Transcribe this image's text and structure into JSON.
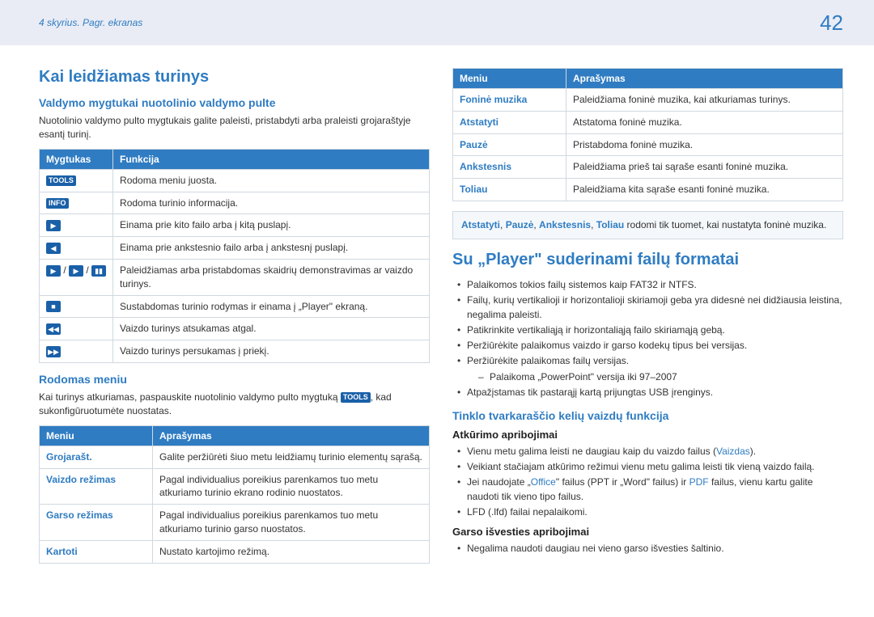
{
  "header": {
    "breadcrumb": "4 skyrius. Pagr. ekranas",
    "page": "42"
  },
  "left": {
    "h1": "Kai leidžiamas turinys",
    "h2_a": "Valdymo mygtukai nuotolinio valdymo pulte",
    "para_a": "Nuotolinio valdymo pulto mygtukais galite paleisti, pristabdyti arba praleisti grojaraštyje esantį turinį.",
    "table1": {
      "col1": "Mygtukas",
      "col2": "Funkcija",
      "rows": [
        {
          "k": "TOOLS",
          "kt": "badge",
          "v": "Rodoma meniu juosta."
        },
        {
          "k": "INFO",
          "kt": "badge",
          "v": "Rodoma turinio informacija."
        },
        {
          "k": "▶",
          "kt": "box",
          "v": "Einama prie kito failo arba į kitą puslapį."
        },
        {
          "k": "◀",
          "kt": "box",
          "v": "Einama prie ankstesnio failo arba į ankstesnį puslapį."
        },
        {
          "k": "▶ / ▶ / ▮▮",
          "kt": "multi",
          "v": "Paleidžiamas arba pristabdomas skaidrių demonstravimas ar vaizdo turinys."
        },
        {
          "k": "■",
          "kt": "box",
          "v": "Sustabdomas turinio rodymas ir einama į „Player\" ekraną."
        },
        {
          "k": "◀◀",
          "kt": "box",
          "v": "Vaizdo turinys atsukamas atgal."
        },
        {
          "k": "▶▶",
          "kt": "box",
          "v": "Vaizdo turinys persukamas į priekį."
        }
      ]
    },
    "h2_b": "Rodomas meniu",
    "para_b_pre": "Kai turinys atkuriamas, paspauskite nuotolinio valdymo pulto mygtuką ",
    "para_b_badge": "TOOLS",
    "para_b_post": ", kad sukonfigūruotumėte nuostatas.",
    "table2": {
      "col1": "Meniu",
      "col2": "Aprašymas",
      "rows": [
        {
          "k": "Grojarašt.",
          "v": "Galite peržiūrėti šiuo metu leidžiamų turinio elementų sąrašą."
        },
        {
          "k": "Vaizdo režimas",
          "v": "Pagal individualius poreikius parenkamos tuo metu atkuriamo turinio ekrano rodinio nuostatos."
        },
        {
          "k": "Garso režimas",
          "v": "Pagal individualius poreikius parenkamos tuo metu atkuriamo turinio garso nuostatos."
        },
        {
          "k": "Kartoti",
          "v": "Nustato kartojimo režimą."
        }
      ]
    }
  },
  "right": {
    "table3": {
      "col1": "Meniu",
      "col2": "Aprašymas",
      "rows": [
        {
          "k": "Foninė muzika",
          "v": "Paleidžiama foninė muzika, kai atkuriamas turinys."
        },
        {
          "k": "Atstatyti",
          "v": "Atstatoma foninė muzika."
        },
        {
          "k": "Pauzė",
          "v": "Pristabdoma foninė muzika."
        },
        {
          "k": "Ankstesnis",
          "v": "Paleidžiama prieš tai sąraše esanti foninė muzika."
        },
        {
          "k": "Toliau",
          "v": "Paleidžiama kita sąraše esanti foninė muzika."
        }
      ]
    },
    "note": {
      "k1": "Atstatyti",
      "s1": ", ",
      "k2": "Pauzė",
      "s2": ", ",
      "k3": "Ankstesnis",
      "s3": ", ",
      "k4": "Toliau",
      "tail": " rodomi tik tuomet, kai nustatyta foninė muzika."
    },
    "h1": "Su „Player\" suderinami failų formatai",
    "bullets1": [
      "Palaikomos tokios failų sistemos kaip FAT32 ir NTFS.",
      "Failų, kurių vertikalioji ir horizontalioji skiriamoji geba yra didesnė nei didžiausia leistina, negalima paleisti.",
      "Patikrinkite vertikaliąją ir horizontaliąją failo skiriamąją gebą.",
      "Peržiūrėkite palaikomus vaizdo ir garso kodekų tipus bei versijas.",
      "Peržiūrėkite palaikomas failų versijas.",
      "Atpažįstamas tik pastarąjį kartą prijungtas USB įrenginys."
    ],
    "sub1": "Palaikoma „PowerPoint\" versija iki 97–2007",
    "h2": "Tinklo tvarkaraščio kelių vaizdų funkcija",
    "h3_a": "Atkūrimo apribojimai",
    "bullets2_a_pre": "Vienu metu galima leisti ne daugiau kaip du vaizdo failus (",
    "bullets2_a_hl": "Vaizdas",
    "bullets2_a_post": ").",
    "bullets2_b": "Veikiant stačiajam atkūrimo režimui vienu metu galima leisti tik vieną vaizdo failą.",
    "bullets2_c_pre": "Jei naudojate „",
    "bullets2_c_hl1": "Office",
    "bullets2_c_mid": "\" failus (PPT ir „Word\" failus) ir ",
    "bullets2_c_hl2": "PDF",
    "bullets2_c_post": " failus, vienu kartu galite naudoti tik vieno tipo failus.",
    "bullets2_d": "LFD (.lfd) failai nepalaikomi.",
    "h3_b": "Garso išvesties apribojimai",
    "bullets3_a": "Negalima naudoti daugiau nei vieno garso išvesties šaltinio."
  }
}
